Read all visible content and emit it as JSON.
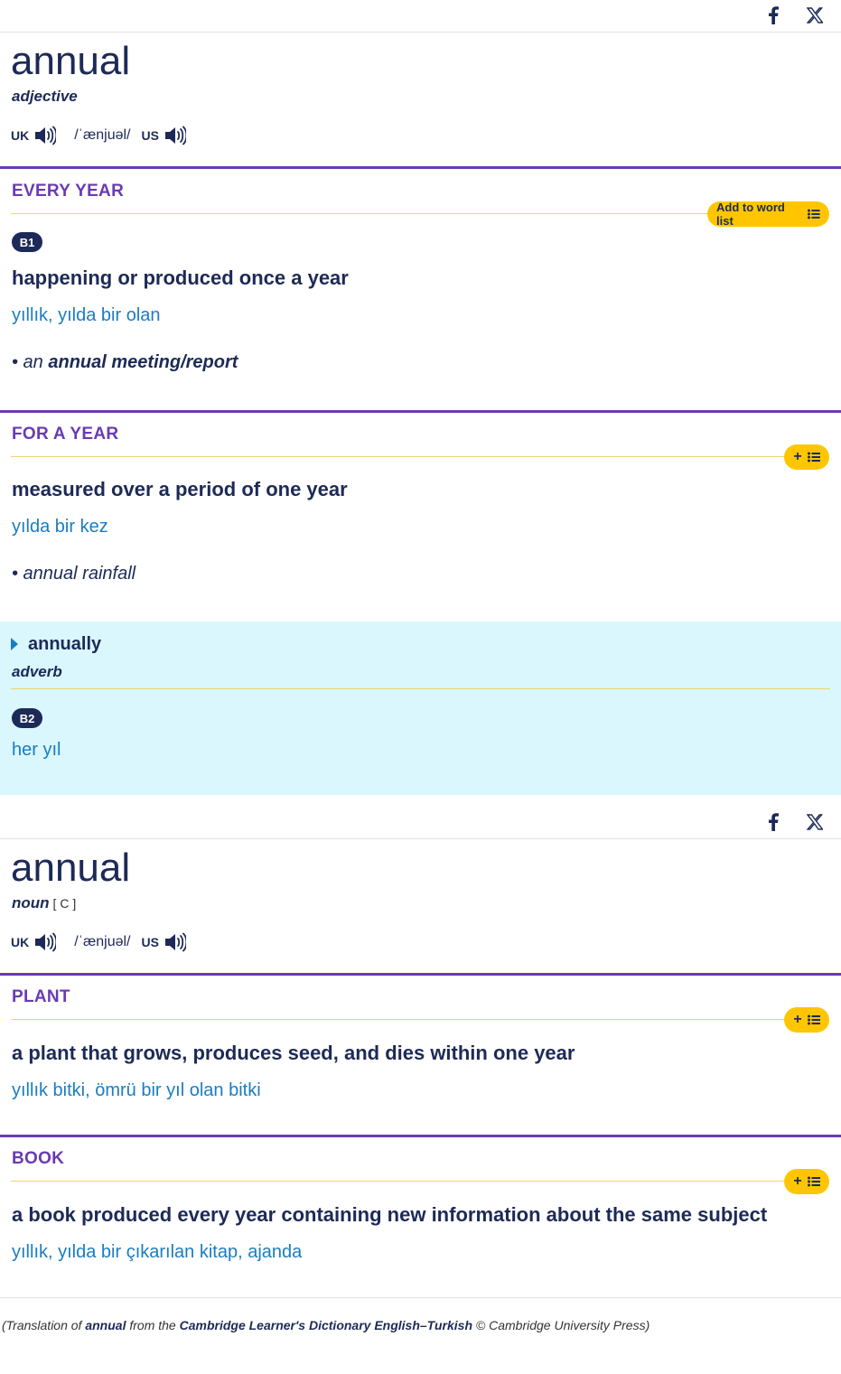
{
  "social": {
    "facebook": "facebook-icon",
    "x": "x-icon"
  },
  "entry1": {
    "headword": "annual",
    "pos": "adjective",
    "pron": {
      "uk_label": "UK",
      "ipa": "/ˈænjuəl/",
      "us_label": "US"
    },
    "senses": [
      {
        "guideword": "EVERY YEAR",
        "wordlist_label": "Add to word list",
        "level": "B1",
        "definition": "happening or produced once a year",
        "translation": "yıllık, yılda bir olan",
        "example_prefix": "• an ",
        "example_bold": "annual meeting/report"
      },
      {
        "guideword": "FOR A YEAR",
        "wordlist_label": "+",
        "definition": "measured over a period of one year",
        "translation": "yılda bir kez",
        "example": "• annual rainfall"
      }
    ],
    "runon": {
      "word": "annually",
      "pos": "adverb",
      "level": "B2",
      "translation": "her yıl"
    }
  },
  "entry2": {
    "headword": "annual",
    "pos": "noun",
    "grammar": "[ C ]",
    "pron": {
      "uk_label": "UK",
      "ipa": "/ˈænjuəl/",
      "us_label": "US"
    },
    "senses": [
      {
        "guideword": "PLANT",
        "wordlist_label": "+",
        "definition": "a plant that grows, produces seed, and dies within one year",
        "translation": "yıllık bitki, ömrü bir yıl olan bitki"
      },
      {
        "guideword": "BOOK",
        "wordlist_label": "+",
        "definition": "a book produced every year containing new information about the same subject",
        "translation": "yıllık, yılda bir çıkarılan kitap, ajanda"
      }
    ]
  },
  "footer": {
    "prefix": "(Translation of ",
    "word": "annual",
    "middle": " from the ",
    "source": "Cambridge Learner's Dictionary English–Turkish",
    "suffix": " © Cambridge University Press)"
  },
  "colors": {
    "accent": "#6a3ab3",
    "button": "#ffc600",
    "translation": "#1a7dc2",
    "runon_bg": "#d9f7fc",
    "text": "#1d2a57"
  }
}
